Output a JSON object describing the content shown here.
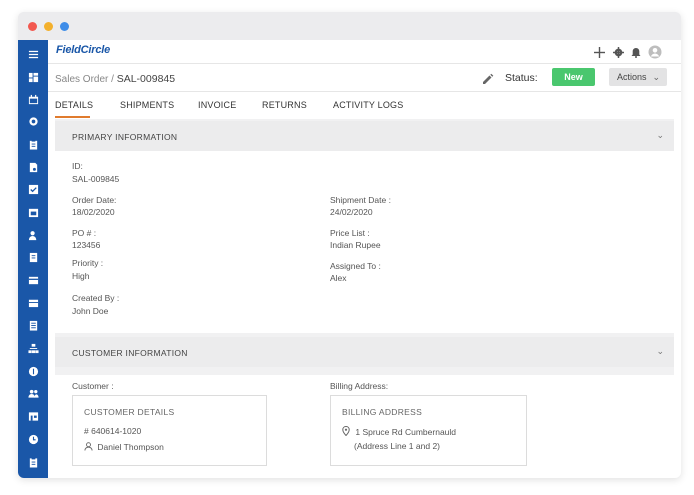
{
  "app": {
    "brand": "FieldCircle"
  },
  "breadcrumb": {
    "parent": "Sales Order",
    "separator": " / ",
    "current": "SAL-009845"
  },
  "status": {
    "label": "Status:",
    "value": "New",
    "color": "#4ac76e"
  },
  "actions": {
    "label": "Actions"
  },
  "tabs": [
    {
      "label": "DETAILS",
      "active": true
    },
    {
      "label": "SHIPMENTS"
    },
    {
      "label": "INVOICE"
    },
    {
      "label": "RETURNS"
    },
    {
      "label": "ACTIVITY LOGS"
    }
  ],
  "primary": {
    "title": "PRIMARY INFORMATION",
    "id_label": "ID:",
    "id_value": "SAL-009845",
    "order_date_label": "Order Date:",
    "order_date_value": "18/02/2020",
    "shipment_date_label": "Shipment Date :",
    "shipment_date_value": "24/02/2020",
    "po_label": "PO # :",
    "po_value": "123456",
    "price_list_label": "Price List :",
    "price_list_value": "Indian Rupee",
    "priority_label": "Priority :",
    "priority_value": "High",
    "assigned_label": "Assigned To :",
    "assigned_value": "Alex",
    "created_label": "Created By :",
    "created_value": "John Doe"
  },
  "customer": {
    "title": "CUSTOMER INFORMATION",
    "customer_label": "Customer :",
    "billing_label": "Billing Address:",
    "details_title": "CUSTOMER DETAILS",
    "details_number": "# 640614-1020",
    "details_name": "Daniel Thompson",
    "billing_title": "BILLING ADDRESS",
    "billing_line1": "1 Spruce Rd Cumbernauld",
    "billing_line2": "(Address Line 1 and 2)"
  },
  "colors": {
    "sidebar": "#1a57a8",
    "accent": "#e07b2d"
  }
}
